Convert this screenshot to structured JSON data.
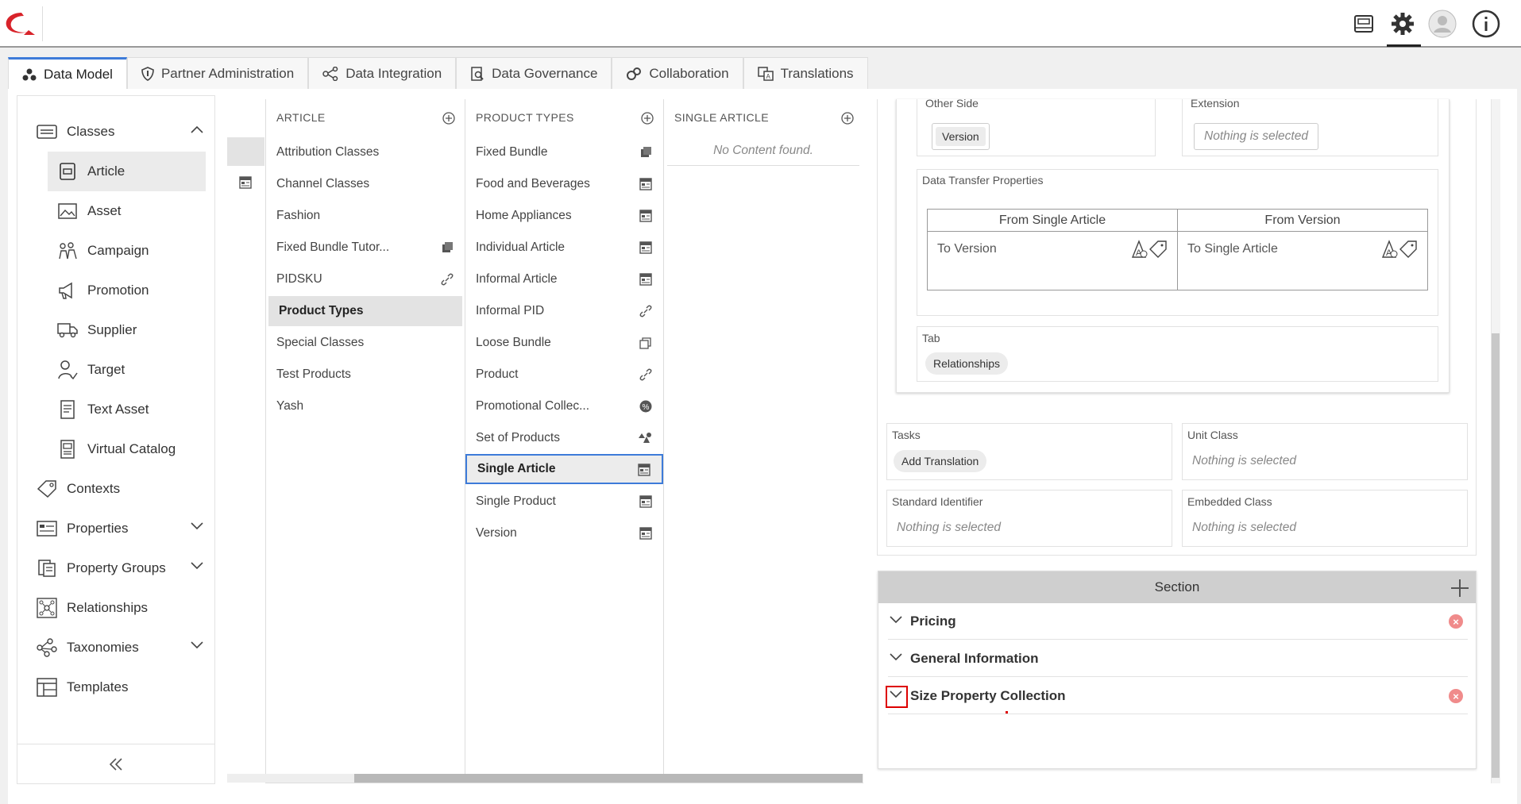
{
  "topbar": {
    "icons": [
      "inbox-icon",
      "settings-gear-icon",
      "user-avatar-icon",
      "info-icon"
    ]
  },
  "tabs": [
    {
      "label": "Data Model",
      "icon": "data-model-icon",
      "active": true
    },
    {
      "label": "Partner Administration",
      "icon": "shield-icon"
    },
    {
      "label": "Data Integration",
      "icon": "integration-icon"
    },
    {
      "label": "Data Governance",
      "icon": "governance-icon"
    },
    {
      "label": "Collaboration",
      "icon": "collaboration-icon"
    },
    {
      "label": "Translations",
      "icon": "translations-icon"
    }
  ],
  "sidebar": {
    "classes": "Classes",
    "sub": [
      "Article",
      "Asset",
      "Campaign",
      "Promotion",
      "Supplier",
      "Target",
      "Text Asset",
      "Virtual Catalog"
    ],
    "items": [
      "Contexts",
      "Properties",
      "Property Groups",
      "Relationships",
      "Taxonomies",
      "Templates"
    ]
  },
  "columns": {
    "article": {
      "header": "ARTICLE",
      "rows": [
        "Attribution Classes",
        "Channel Classes",
        "Fashion",
        "Fixed Bundle Tutor...",
        "PIDSKU",
        "Product Types",
        "Special Classes",
        "Test Products",
        "Yash"
      ]
    },
    "product_types": {
      "header": "PRODUCT TYPES",
      "rows": [
        "Fixed Bundle",
        "Food and Beverages",
        "Home Appliances",
        "Individual Article",
        "Informal Article",
        "Informal PID",
        "Loose Bundle",
        "Product",
        "Promotional Collec...",
        "Set of Products",
        "Single Article",
        "Single Product",
        "Version"
      ]
    },
    "single_article": {
      "header": "SINGLE ARTICLE",
      "empty": "No Content found."
    }
  },
  "details": {
    "other_side_label": "Other Side",
    "other_side_value": "Version",
    "extension_label": "Extension",
    "nothing": "Nothing is selected",
    "dtp_label": "Data Transfer Properties",
    "dtp_from_single": "From Single Article",
    "dtp_from_version": "From Version",
    "dtp_to_version": "To Version",
    "dtp_to_single": "To Single Article",
    "tab_label": "Tab",
    "tab_value": "Relationships",
    "tasks_label": "Tasks",
    "tasks_value": "Add Translation",
    "unit_class_label": "Unit Class",
    "std_id_label": "Standard Identifier",
    "embedded_label": "Embedded Class"
  },
  "section": {
    "title": "Section",
    "rows": [
      "Pricing",
      "General Information",
      "Size Property Collection"
    ]
  }
}
